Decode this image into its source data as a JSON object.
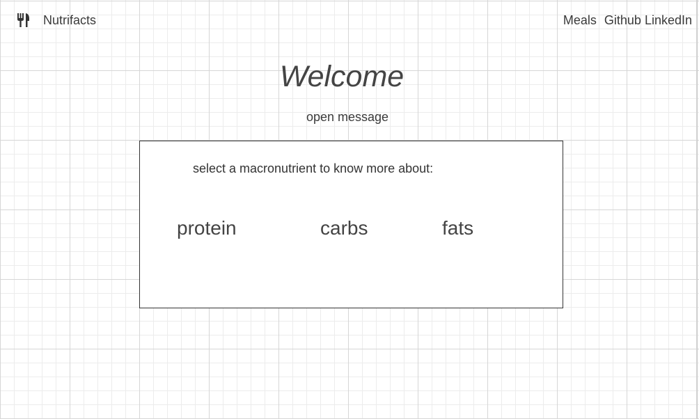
{
  "header": {
    "logo_icon": "utensils-icon",
    "brand": "Nutrifacts",
    "nav": {
      "meals": "Meals",
      "github": "Github",
      "linkedin": "LinkedIn"
    }
  },
  "main": {
    "title": "Welcome",
    "open_message": "open message",
    "macro_panel": {
      "prompt": "select a macronutrient to know more about:",
      "options": {
        "protein": "protein",
        "carbs": "carbs",
        "fats": "fats"
      }
    }
  }
}
